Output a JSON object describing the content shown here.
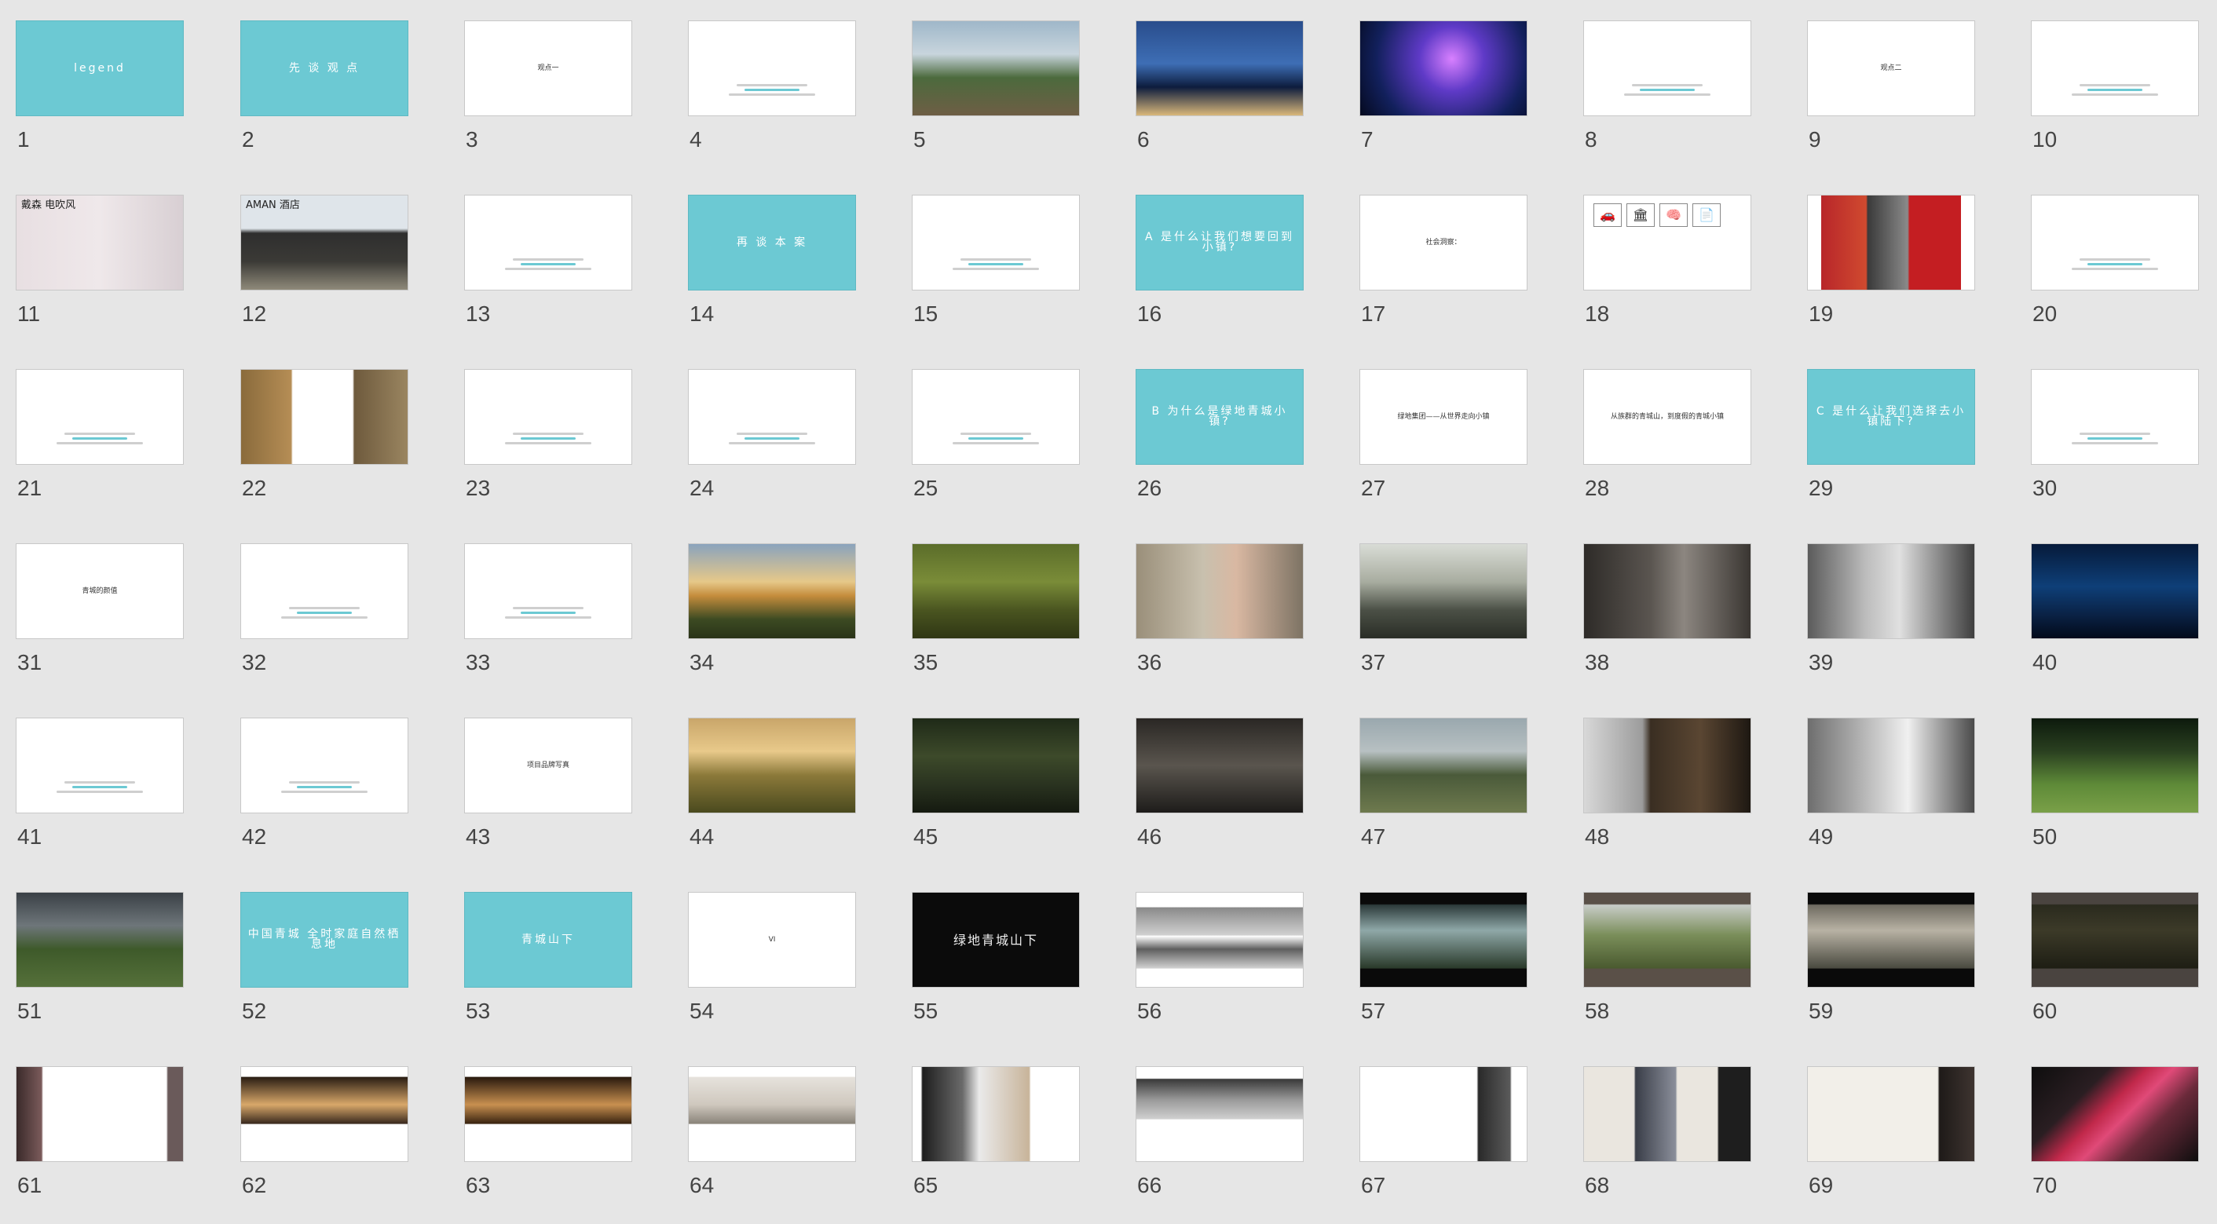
{
  "view": "slide-sorter",
  "accent_color": "#6cc9d3",
  "slides": [
    {
      "number": "1",
      "text": "legend",
      "style": "teal"
    },
    {
      "number": "2",
      "text": "先 谈 观 点",
      "style": "teal"
    },
    {
      "number": "3",
      "text": "观点一",
      "style": "text"
    },
    {
      "number": "4",
      "text": "",
      "style": "text"
    },
    {
      "number": "5",
      "text": "",
      "style": "photo",
      "caption": "",
      "bg": "linear-gradient(180deg,#9fb7c9 0%,#c8d5dd 35%,#4c6a3d 60%,#6e5e45 100%)"
    },
    {
      "number": "6",
      "text": "",
      "style": "photo",
      "caption": "",
      "bg": "linear-gradient(180deg,#294d8c 0%,#3e6eb5 45%,#0d1c3d 70%,#d9b77a 100%)"
    },
    {
      "number": "7",
      "text": "",
      "style": "photo",
      "caption": "",
      "bg": "radial-gradient(circle at 55% 40%,#d880ff 0%,#5f3ac7 30%,#12205c 70%,#050a1f 100%)"
    },
    {
      "number": "8",
      "text": "",
      "style": "text"
    },
    {
      "number": "9",
      "text": "观点二",
      "style": "text"
    },
    {
      "number": "10",
      "text": "",
      "style": "text"
    },
    {
      "number": "11",
      "text": "戴森 电吹风",
      "style": "photo-light",
      "caption": "",
      "bg": "linear-gradient(90deg,#e8dfe2 0%,#efe8ea 50%,#d8cfd3 100%)"
    },
    {
      "number": "12",
      "text": "AMAN 酒店",
      "style": "photo-light",
      "caption": "",
      "bg": "linear-gradient(180deg,#dfe5ea 0%,#dfe5ea 35%,#2e2e2e 40%,#3b3a36 70%,#8f8a7a 100%)"
    },
    {
      "number": "13",
      "text": "",
      "style": "text"
    },
    {
      "number": "14",
      "text": "再 谈 本 案",
      "style": "teal"
    },
    {
      "number": "15",
      "text": "",
      "style": "text"
    },
    {
      "number": "16",
      "text": "A 是什么让我们想要回到小镇?",
      "style": "teal"
    },
    {
      "number": "17",
      "text": "社会洞察：",
      "style": "text"
    },
    {
      "number": "18",
      "text": "",
      "style": "icons"
    },
    {
      "number": "19",
      "text": "",
      "style": "photo-light",
      "caption": "",
      "bg": "linear-gradient(90deg,#ffffff 0%,#ffffff 8%,#b8262a 8%,#d04a2f 35%,#3a3a3a 36%,#8a8a8a 60%,#c41e22 61%,#c41e22 92%,#ffffff 92%)"
    },
    {
      "number": "20",
      "text": "",
      "style": "text"
    },
    {
      "number": "21",
      "text": "",
      "style": "text"
    },
    {
      "number": "22",
      "text": "",
      "style": "photo-light",
      "caption": "",
      "bg": "linear-gradient(90deg,#8a6b3c 0%,#b58d55 30%,#ffffff 31%,#ffffff 67%,#6e5a3d 68%,#9a8560 100%)"
    },
    {
      "number": "23",
      "text": "",
      "style": "text"
    },
    {
      "number": "24",
      "text": "",
      "style": "text"
    },
    {
      "number": "25",
      "text": "",
      "style": "text"
    },
    {
      "number": "26",
      "text": "B 为什么是绿地青城小镇?",
      "style": "teal"
    },
    {
      "number": "27",
      "text": "绿地集团——从世界走向小镇",
      "style": "text"
    },
    {
      "number": "28",
      "text": "从族群的青城山，到度假的青城小镇",
      "style": "text"
    },
    {
      "number": "29",
      "text": "C 是什么让我们选择去小镇陆下?",
      "style": "teal"
    },
    {
      "number": "30",
      "text": "",
      "style": "text"
    },
    {
      "number": "31",
      "text": "青城的颜值",
      "style": "text"
    },
    {
      "number": "32",
      "text": "",
      "style": "text"
    },
    {
      "number": "33",
      "text": "",
      "style": "text"
    },
    {
      "number": "34",
      "text": "",
      "style": "photo",
      "caption": "",
      "bg": "linear-gradient(180deg,#8aa3bd 0%,#e6c889 40%,#c48c3c 55%,#3c4a22 80%,#2a3318 100%)"
    },
    {
      "number": "35",
      "text": "",
      "style": "photo",
      "caption": "",
      "bg": "linear-gradient(180deg,#5b6d2a 0%,#7a8c38 40%,#4a5520 70%,#2f3614 100%)"
    },
    {
      "number": "36",
      "text": "",
      "style": "photo",
      "caption": "",
      "bg": "linear-gradient(90deg,#9a8f7a 0%,#c8c0ae 40%,#d9b8a2 60%,#7d7364 100%)"
    },
    {
      "number": "37",
      "text": "",
      "style": "photo",
      "caption": "",
      "bg": "linear-gradient(180deg,#d9dcd6 0%,#a8ada0 40%,#4b5046 70%,#2a2d26 100%)"
    },
    {
      "number": "38",
      "text": "",
      "style": "photo",
      "caption": "",
      "bg": "linear-gradient(90deg,#2e2b28 0%,#5a5550 40%,#8c8680 60%,#3a3632 100%)"
    },
    {
      "number": "39",
      "text": "",
      "style": "photo",
      "caption": "",
      "bg": "linear-gradient(90deg,#5b5b5b 0%,#bdbdbd 35%,#e0e0e0 55%,#3e3e3e 100%)"
    },
    {
      "number": "40",
      "text": "",
      "style": "photo",
      "caption": "",
      "bg": "linear-gradient(180deg,#061a3a 0%,#0e3f78 45%,#0a2245 75%,#020a1a 100%)"
    },
    {
      "number": "41",
      "text": "",
      "style": "text"
    },
    {
      "number": "42",
      "text": "",
      "style": "text"
    },
    {
      "number": "43",
      "text": "项目品牌写真",
      "style": "text"
    },
    {
      "number": "44",
      "text": "",
      "style": "photo",
      "caption": "",
      "bg": "linear-gradient(180deg,#c9a66a 0%,#e8c98a 35%,#8c7a3a 60%,#4a4a1e 100%)"
    },
    {
      "number": "45",
      "text": "",
      "style": "photo",
      "caption": "",
      "bg": "linear-gradient(180deg,#1f2a18 0%,#3d4a2a 40%,#2a3320 70%,#151a10 100%)"
    },
    {
      "number": "46",
      "text": "",
      "style": "photo",
      "caption": "",
      "bg": "linear-gradient(180deg,#2a2724 0%,#5a554e 50%,#1e1c1a 100%)"
    },
    {
      "number": "47",
      "text": "",
      "style": "photo",
      "caption": "",
      "bg": "linear-gradient(180deg,#9aa8ae 0%,#b7c0c2 35%,#4a5a3a 60%,#6e7a4e 100%)"
    },
    {
      "number": "48",
      "text": "",
      "style": "photo",
      "caption": "",
      "bg": "linear-gradient(90deg,#d8d8d8 0%,#9c9c9c 35%,#3a2e22 40%,#5a4632 70%,#1e1812 100%)"
    },
    {
      "number": "49",
      "text": "",
      "style": "photo",
      "caption": "",
      "bg": "linear-gradient(90deg,#6e6e6e 0%,#c4c4c4 40%,#f0f0f0 60%,#4a4a4a 100%)"
    },
    {
      "number": "50",
      "text": "",
      "style": "photo",
      "caption": "",
      "bg": "linear-gradient(180deg,#0d1a0d 0%,#2a4020 35%,#5e8a38 70%,#7aa048 100%)"
    },
    {
      "number": "51",
      "text": "",
      "style": "photo",
      "caption": "",
      "bg": "linear-gradient(180deg,#3a4046 0%,#6e767a 35%,#3e5a2a 60%,#55703a 100%)"
    },
    {
      "number": "52",
      "text": "中国青城 全时家庭自然栖息地",
      "style": "teal"
    },
    {
      "number": "53",
      "text": "青城山下",
      "style": "teal"
    },
    {
      "number": "54",
      "text": "VI",
      "style": "text"
    },
    {
      "number": "55",
      "text": "绿地青城山下",
      "style": "black"
    },
    {
      "number": "56",
      "text": "",
      "style": "photo-light",
      "caption": "",
      "bg": "linear-gradient(180deg,#ffffff 0%,#ffffff 15%,#8a8a8a 16%,#d0d0d0 45%,#ffffff 46%,#5e5e5e 60%,#cfcfcf 80%,#ffffff 81%)"
    },
    {
      "number": "57",
      "text": "",
      "style": "photo",
      "caption": "",
      "bg": "linear-gradient(180deg,#0a0a0a 0%,#0a0a0a 12%,#2c3a3a 13%,#8fa8a8 40%,#2a3a2a 80%,#0a0a0a 81%)"
    },
    {
      "number": "58",
      "text": "",
      "style": "photo",
      "caption": "",
      "bg": "linear-gradient(180deg,#5a5048 0%,#5a5048 12%,#c8ccc8 13%,#7a8e5a 45%,#4a5a30 80%,#5a5048 81%)"
    },
    {
      "number": "59",
      "text": "",
      "style": "photo",
      "caption": "",
      "bg": "linear-gradient(180deg,#0a0a0a 0%,#0a0a0a 12%,#6e6a60 13%,#b8b2a4 40%,#4a4a40 80%,#0a0a0a 81%)"
    },
    {
      "number": "60",
      "text": "",
      "style": "photo",
      "caption": "",
      "bg": "linear-gradient(180deg,#4a4440 0%,#4a4440 12%,#2a2a1e 13%,#3c3a28 40%,#1e1e14 80%,#4a4440 81%)"
    },
    {
      "number": "61",
      "text": "",
      "style": "photo",
      "caption": "",
      "bg": "linear-gradient(90deg,#3a2a2a 0%,#7a5a5a 15%,#ffffff 16%,#ffffff 90%,#6a5a5a 91%)"
    },
    {
      "number": "62",
      "text": "",
      "style": "photo-light",
      "caption": "",
      "bg": "linear-gradient(180deg,#ffffff 0%,#ffffff 10%,#2a1e14 11%,#d8a86a 40%,#3a2a1e 60%,#ffffff 61%)"
    },
    {
      "number": "63",
      "text": "",
      "style": "photo-light",
      "caption": "",
      "bg": "linear-gradient(180deg,#ffffff 0%,#ffffff 10%,#2a1a0e 11%,#c89050 40%,#3a2410 60%,#ffffff 61%)"
    },
    {
      "number": "64",
      "text": "",
      "style": "photo-light",
      "caption": "",
      "bg": "linear-gradient(180deg,#ffffff 0%,#ffffff 10%,#e6e2dc 11%,#cfc8be 40%,#8a847a 60%,#ffffff 61%)"
    },
    {
      "number": "65",
      "text": "",
      "style": "photo-light",
      "caption": "",
      "bg": "linear-gradient(90deg,#ffffff 0%,#ffffff 5%,#1e1e1e 6%,#6a6a6a 30%,#eaeaea 40%,#c8b49a 70%,#ffffff 71%)"
    },
    {
      "number": "66",
      "text": "",
      "style": "photo-light",
      "caption": "",
      "bg": "linear-gradient(180deg,#ffffff 0%,#ffffff 12%,#3a3a3a 13%,#9a9a9a 35%,#cfcfcf 55%,#ffffff 56%)"
    },
    {
      "number": "67",
      "text": "",
      "style": "photo-light",
      "caption": "",
      "bg": "linear-gradient(90deg,#ffffff 0%,#ffffff 70%,#2a2a2a 71%,#5a5a5a 90%,#ffffff 91%)"
    },
    {
      "number": "68",
      "text": "",
      "style": "photo-light",
      "caption": "",
      "bg": "linear-gradient(90deg,#eae6df 0%,#eae6df 30%,#3a3e48 31%,#8a8e9a 55%,#eae6df 56%,#eae6df 80%,#1e1e1e 81%)"
    },
    {
      "number": "69",
      "text": "",
      "style": "photo-light",
      "caption": "",
      "bg": "linear-gradient(90deg,#f2efe9 0%,#f2efe9 78%,#1e1a18 79%,#3e3430 100%)"
    },
    {
      "number": "70",
      "text": "",
      "style": "photo",
      "caption": "",
      "bg": "linear-gradient(135deg,#0e0e0e 0%,#2a1e22 30%,#c0284a 45%,#e04a78 55%,#6a2a3a 70%,#0e0e0e 100%)"
    }
  ]
}
